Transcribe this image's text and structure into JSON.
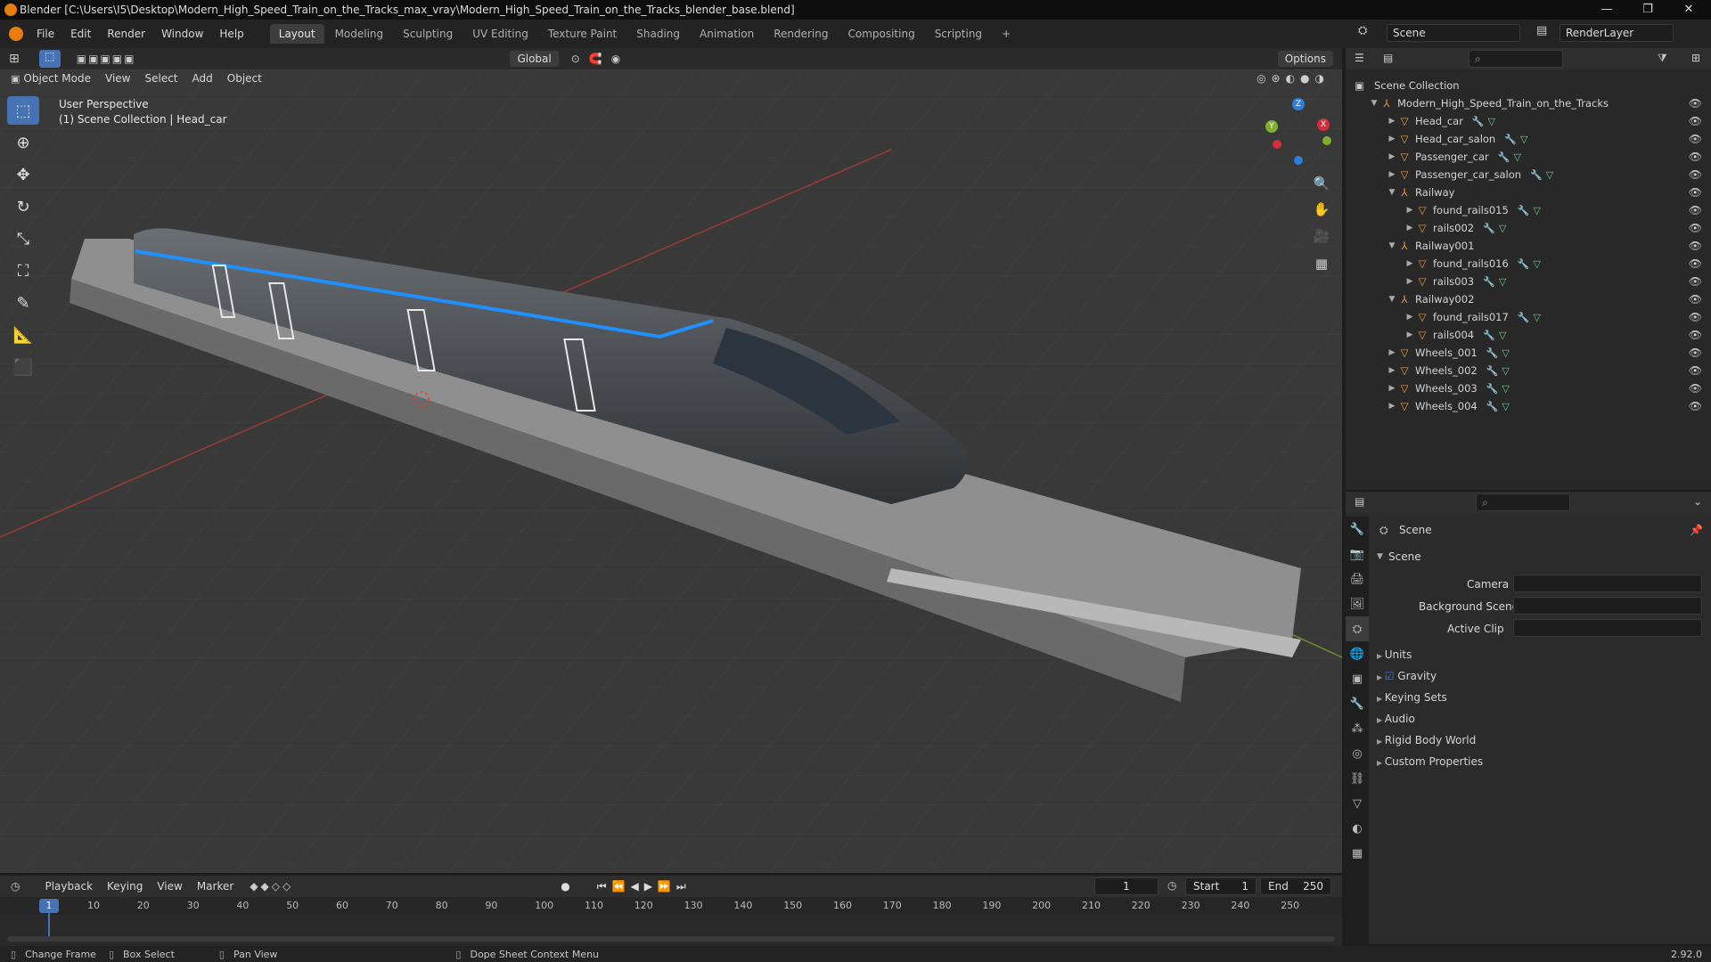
{
  "titlebar": {
    "title": "Blender [C:\\Users\\I5\\Desktop\\Modern_High_Speed_Train_on_the_Tracks_max_vray\\Modern_High_Speed_Train_on_the_Tracks_blender_base.blend]",
    "minimize": "—",
    "maximize": "❐",
    "close": "✕"
  },
  "menubar": {
    "menus": [
      "File",
      "Edit",
      "Render",
      "Window",
      "Help"
    ],
    "workspaces": [
      "Layout",
      "Modeling",
      "Sculpting",
      "UV Editing",
      "Texture Paint",
      "Shading",
      "Animation",
      "Rendering",
      "Compositing",
      "Scripting"
    ],
    "add_workspace": "+",
    "scene_name": "Scene",
    "render_layer": "RenderLayer"
  },
  "viewport_header": {
    "mode": "Object Mode",
    "menus": [
      "View",
      "Select",
      "Add",
      "Object"
    ],
    "orientation": "Global",
    "options": "Options"
  },
  "viewport": {
    "perspective": "User Perspective",
    "collection_info": "(1) Scene Collection | Head_car",
    "gizmo": {
      "x": "X",
      "y": "Y",
      "z": "Z"
    }
  },
  "outliner": {
    "root": "Scene Collection",
    "items": [
      {
        "label": "Modern_High_Speed_Train_on_the_Tracks",
        "type": "empty",
        "expanded": true
      },
      {
        "label": "Head_car",
        "type": "mesh"
      },
      {
        "label": "Head_car_salon",
        "type": "mesh"
      },
      {
        "label": "Passenger_car",
        "type": "mesh"
      },
      {
        "label": "Passenger_car_salon",
        "type": "mesh"
      },
      {
        "label": "Railway",
        "type": "empty",
        "expanded": true
      },
      {
        "label": "found_rails015",
        "type": "mesh"
      },
      {
        "label": "rails002",
        "type": "mesh"
      },
      {
        "label": "Railway001",
        "type": "empty",
        "expanded": true
      },
      {
        "label": "found_rails016",
        "type": "mesh"
      },
      {
        "label": "rails003",
        "type": "mesh"
      },
      {
        "label": "Railway002",
        "type": "empty",
        "expanded": true
      },
      {
        "label": "found_rails017",
        "type": "mesh"
      },
      {
        "label": "rails004",
        "type": "mesh"
      },
      {
        "label": "Wheels_001",
        "type": "mesh"
      },
      {
        "label": "Wheels_002",
        "type": "mesh"
      },
      {
        "label": "Wheels_003",
        "type": "mesh"
      },
      {
        "label": "Wheels_004",
        "type": "mesh"
      }
    ]
  },
  "properties": {
    "breadcrumb": "Scene",
    "panel_title": "Scene",
    "fields": {
      "camera": "Camera",
      "background_scene": "Background Scene",
      "active_clip": "Active Clip"
    },
    "sections": [
      "Units",
      "Gravity",
      "Keying Sets",
      "Audio",
      "Rigid Body World",
      "Custom Properties"
    ],
    "gravity_checked": true
  },
  "timeline": {
    "menus": [
      "Playback",
      "Keying",
      "View",
      "Marker"
    ],
    "current_frame": "1",
    "start_label": "Start",
    "start": "1",
    "end_label": "End",
    "end": "250",
    "ruler": [
      "10",
      "20",
      "30",
      "40",
      "50",
      "60",
      "70",
      "80",
      "90",
      "100",
      "110",
      "120",
      "130",
      "140",
      "150",
      "160",
      "170",
      "180",
      "190",
      "200",
      "210",
      "220",
      "230",
      "240",
      "250"
    ],
    "playhead": "1"
  },
  "statusbar": {
    "items": [
      "Change Frame",
      "Box Select",
      "Pan View",
      "Dope Sheet Context Menu"
    ],
    "version": "2.92.0"
  }
}
